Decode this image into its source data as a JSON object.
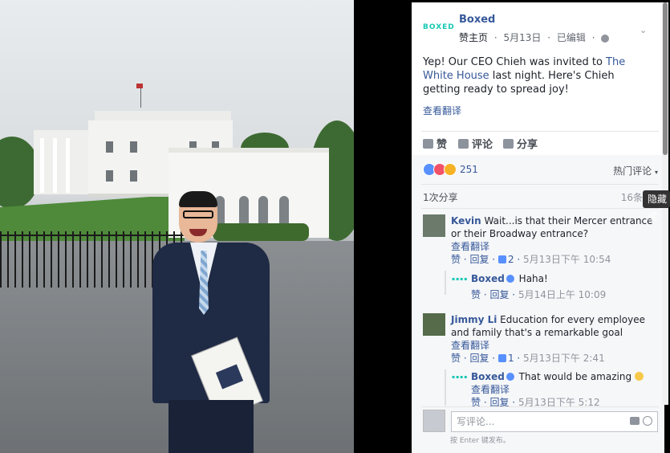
{
  "post": {
    "page_name": "Boxed",
    "page_logo_text": "BOXED",
    "meta_home": "赞主页",
    "meta_date": "5月13日",
    "meta_edited": "已编辑",
    "text_before": "Yep! Our CEO Chieh was invited to ",
    "text_link": "The White House",
    "text_after": " last night. Here's Chieh getting ready to spread joy!",
    "see_translation": "查看翻译"
  },
  "actions": {
    "like": "赞",
    "comment": "评论",
    "share": "分享"
  },
  "stats": {
    "reaction_count": "251",
    "sort_label": "热门评论",
    "shares": "1次分享",
    "comments_count": "16条",
    "tooltip": "隐藏或"
  },
  "comments": [
    {
      "name": "Kevin",
      "text": " Wait...is that their Mercer entrance or their Broadway entrance?",
      "translate": "查看翻译",
      "like": "赞",
      "reply": "回复",
      "likes": "2",
      "time": "5月13日下午 10:54"
    },
    {
      "name": "Boxed",
      "text": " Haha!",
      "like": "赞",
      "reply": "回复",
      "time": "5月14日上午 10:09"
    },
    {
      "name": "Jimmy Li",
      "text": " Education for every employee and family that's a remarkable goal",
      "translate": "查看翻译",
      "like": "赞",
      "reply": "回复",
      "likes": "1",
      "time": "5月13日下午 2:41"
    },
    {
      "name": "Boxed",
      "text": " That would be amazing",
      "translate": "查看翻译",
      "like": "赞",
      "reply": "回复",
      "time": "5月13日下午 5:12"
    }
  ],
  "composer": {
    "placeholder": "写评论...",
    "hint": "按 Enter 键发布。"
  },
  "colors": {
    "link": "#365899",
    "brand_teal": "#17c8b4",
    "like_blue": "#5890ff",
    "heart_red": "#f25268",
    "wow_yellow": "#f7b125"
  },
  "icons": [
    "globe-icon",
    "chevron-down-icon",
    "like-icon",
    "comment-icon",
    "share-icon",
    "camera-icon",
    "emoji-icon",
    "verified-icon"
  ]
}
